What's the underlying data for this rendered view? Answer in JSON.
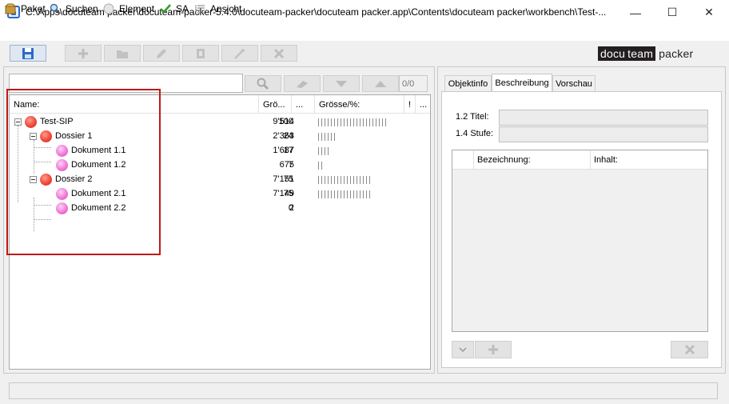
{
  "window": {
    "title": "C:\\Apps\\docuteam packer\\docuteam-packer-5.4.0\\docuteam-packer\\docuteam packer.app\\Contents\\docuteam packer\\workbench\\Test-...",
    "minimize": "—",
    "maximize": "☐",
    "close": "✕"
  },
  "menu": {
    "items": [
      {
        "label": "Paket",
        "icon": "package-icon"
      },
      {
        "label": "Suchen",
        "icon": "search-icon"
      },
      {
        "label": "Element",
        "icon": "element-icon"
      },
      {
        "label": "SA",
        "icon": "checkmark-icon"
      },
      {
        "label": "Ansicht",
        "icon": "view-list-icon"
      }
    ]
  },
  "toolbar": {
    "buttons": [
      "save-icon",
      "add-icon",
      "folder-icon",
      "edit-icon",
      "delete-item-icon",
      "magic-wand-icon",
      "remove-icon"
    ]
  },
  "logo": {
    "part1": "docu",
    "part2": "team",
    "part3": "packer"
  },
  "search": {
    "value": "",
    "buttons": [
      "search-icon",
      "clear-icon",
      "arrow-down-icon",
      "arrow-up-icon"
    ],
    "count": "0/0"
  },
  "tree": {
    "columns": [
      "Name:",
      "Grö...",
      "...",
      "Grösse/%:",
      "!",
      "..."
    ],
    "rows": [
      {
        "name": "Test-SIP",
        "size": "9'514",
        "pct": "100",
        "fraction": 1.0,
        "level": 0,
        "type": "sip"
      },
      {
        "name": "Dossier 1",
        "size": "2'363",
        "pct": "24",
        "fraction": 0.24,
        "level": 1,
        "type": "dossier"
      },
      {
        "name": "Dokument 1.1",
        "size": "1'687",
        "pct": "17",
        "fraction": 0.17,
        "level": 2,
        "type": "document"
      },
      {
        "name": "Dokument 1.2",
        "size": "675",
        "pct": "7",
        "fraction": 0.07,
        "level": 2,
        "type": "document"
      },
      {
        "name": "Dossier 2",
        "size": "7'151",
        "pct": "75",
        "fraction": 0.75,
        "level": 1,
        "type": "dossier"
      },
      {
        "name": "Dokument 2.1",
        "size": "7'149",
        "pct": "75",
        "fraction": 0.75,
        "level": 2,
        "type": "document"
      },
      {
        "name": "Dokument 2.2",
        "size": "2",
        "pct": "0",
        "fraction": 0.0,
        "level": 2,
        "type": "document"
      }
    ]
  },
  "details": {
    "tabs": [
      "Objektinfo",
      "Beschreibung",
      "Vorschau"
    ],
    "active_tab": "Beschreibung",
    "fields": [
      {
        "label": "1.2 Titel:",
        "value": ""
      },
      {
        "label": "1.4 Stufe:",
        "value": ""
      }
    ],
    "table_columns": [
      "",
      "Bezeichnung:",
      "Inhalt:"
    ]
  },
  "colors": {
    "highlight": "#c0191a",
    "sip_node": "#f0483a",
    "document_node": "#f07ad8"
  }
}
